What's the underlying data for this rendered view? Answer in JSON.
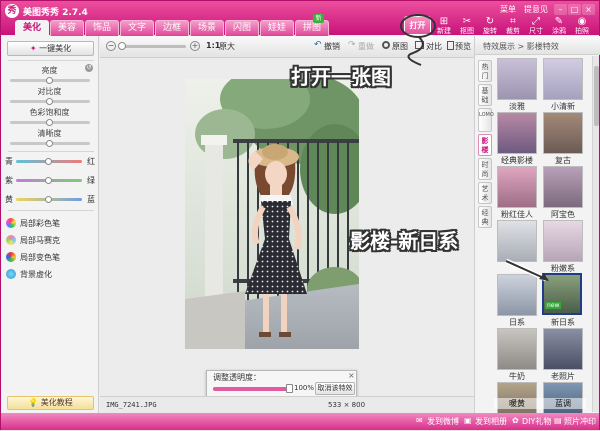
{
  "app": {
    "title": "美图秀秀 2.7.4"
  },
  "topmenu": {
    "menu": "菜单",
    "feedback": "提意见"
  },
  "tabs": [
    "美化",
    "美容",
    "饰品",
    "文字",
    "边框",
    "场景",
    "闪图",
    "娃娃",
    "拼图"
  ],
  "tab_badge": "新",
  "toolbar": {
    "open": "打开",
    "items": [
      "新建",
      "抠图",
      "旋转",
      "裁剪",
      "尺寸",
      "涂鸦",
      "拍照"
    ]
  },
  "left": {
    "onekey": "一键美化",
    "sliders": [
      "亮度",
      "对比度",
      "色彩饱和度",
      "清晰度"
    ],
    "color_rows": [
      {
        "left": "青",
        "right": "红"
      },
      {
        "left": "紫",
        "right": "绿"
      },
      {
        "left": "黄",
        "right": "蓝"
      }
    ],
    "tools": [
      "局部彩色笔",
      "局部马赛克",
      "局部变色笔",
      "背景虚化"
    ],
    "tutorial": "美化教程"
  },
  "center": {
    "zoom_ratio": "1:1",
    "original_size": "原大",
    "undo": "撤销",
    "redo": "重做",
    "original": "原图",
    "compare": "对比",
    "preview": "预览",
    "filename": "IMG_7241.JPG",
    "dimensions": "533 × 800"
  },
  "opacity_dialog": {
    "label": "调整透明度：",
    "value": "100%",
    "cancel": "取消该特效",
    "level": 1.0
  },
  "right": {
    "header": "特效展示 > 影楼特效",
    "vtabs": [
      "热门",
      "基础",
      "LOMO",
      "影楼",
      "时尚",
      "艺术",
      "经典"
    ],
    "effects": [
      "淡雅",
      "小清新",
      "经典影楼",
      "复古",
      "粉红佳人",
      "阿宝色",
      "淡灵",
      "粉嫩系",
      "日系",
      "新日系",
      "牛奶",
      "老照片",
      "暖黄",
      "蓝调"
    ],
    "selected": "新日系",
    "new_tag": "new"
  },
  "bottom": {
    "weibo": "发到微博",
    "album": "发到相册",
    "diy": "DIY礼物",
    "print": "照片冲印"
  },
  "annotations": {
    "open_hint": "打开一张图",
    "effect_hint": "影楼-新日系"
  }
}
